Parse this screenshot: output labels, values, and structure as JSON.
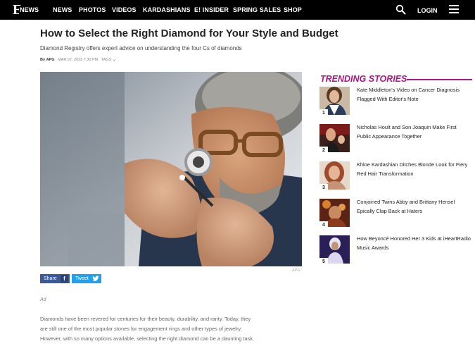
{
  "nav": {
    "logo_letter": "E",
    "logo_text": "NEWS",
    "items": [
      "NEWS",
      "PHOTOS",
      "VIDEOS",
      "KARDASHIANS",
      "E! INSIDER",
      "SPRING SALES",
      "SHOP"
    ],
    "login": "LOGIN"
  },
  "article": {
    "title": "How to Select the Right Diamond for Your Style and Budget",
    "subtitle": "Diamond Registry offers expert advice on understanding the four Cs of diamonds",
    "by": "By",
    "author": "APG",
    "date": "MAR 07, 2023 7:30 PM",
    "tags_label": "TAGS",
    "image_credit": "APG",
    "share_label": "Share",
    "share_icon": "f",
    "tweet_label": "Tweet",
    "ad_label": "Ad",
    "body_lines": [
      "Diamonds have been revered for centuries for their beauty, durability, and rarity. Today, they",
      "are still one of the most popular stones for engagement rings and other types of jewelry.",
      "However, with so many options available, selecting the right diamond can be a daunting task."
    ]
  },
  "trending": {
    "heading": "TRENDING STORIES",
    "stories": [
      {
        "rank": "1",
        "title": "Kate Middleton's Video on Cancer Diagnosis Flagged With Editor's Note"
      },
      {
        "rank": "2",
        "title": "Nicholas Hoult and Son Joaquin Make First Public Appearance Together"
      },
      {
        "rank": "3",
        "title": "Khloe Kardashian Ditches Blonde Look for Fiery Red Hair Transformation"
      },
      {
        "rank": "4",
        "title": "Conjoined Twins Abby and Brittany Hensel Epically Clap Back at Haters"
      },
      {
        "rank": "5",
        "title": "How Beyoncé Honored Her 3 Kids at iHeartRadio Music Awards"
      }
    ]
  },
  "colors": {
    "nav_bg": "#000000",
    "accent": "#b01586",
    "facebook": "#3b5998",
    "twitter": "#1da1f2"
  }
}
